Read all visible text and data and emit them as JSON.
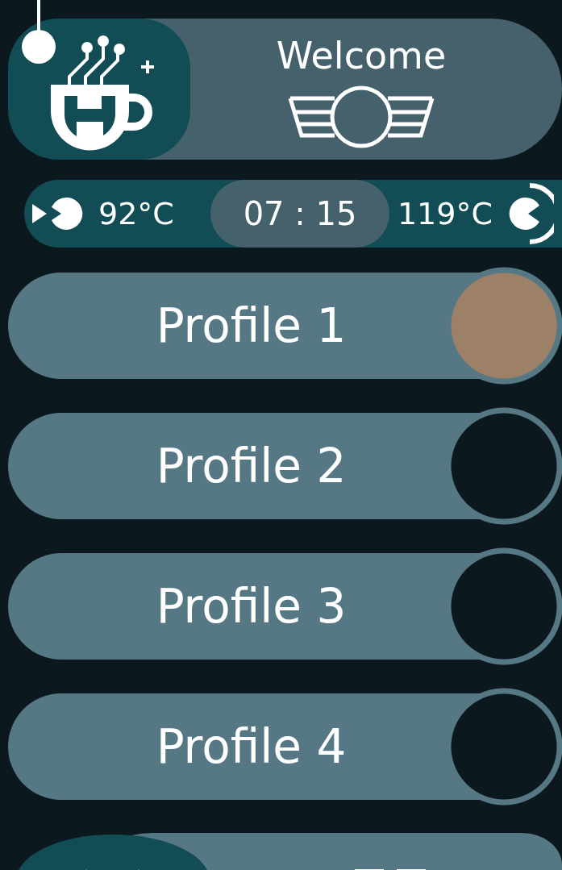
{
  "header": {
    "title": "Welcome"
  },
  "status_bar": {
    "start_temperature": "92°C",
    "time": "07 : 15",
    "end_temperature": "119°C"
  },
  "profiles": [
    {
      "label": "Profile 1",
      "selected": true
    },
    {
      "label": "Profile 2",
      "selected": false
    },
    {
      "label": "Profile 3",
      "selected": false
    },
    {
      "label": "Profile 4",
      "selected": false
    }
  ]
}
